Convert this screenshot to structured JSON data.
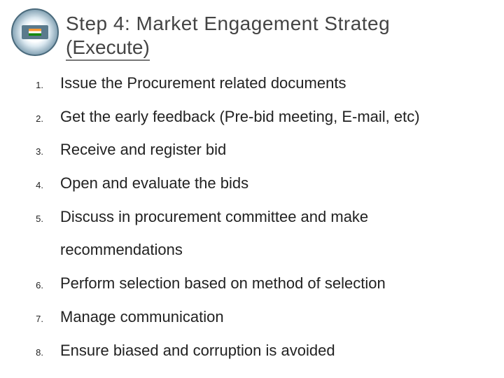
{
  "logo": {
    "name": "institutional-seal"
  },
  "heading": {
    "line1": "Step   4:     Market     Engagement     Strateg",
    "line2": "(Execute)"
  },
  "items": [
    {
      "num": "1.",
      "text": "Issue the Procurement related documents"
    },
    {
      "num": "2.",
      "text": "Get the early feedback (Pre-bid meeting, E-mail, etc)"
    },
    {
      "num": "3.",
      "text": "Receive and register bid"
    },
    {
      "num": "4.",
      "text": "Open and evaluate the bids"
    },
    {
      "num": "5.",
      "text": "Discuss   in   procurement   committee   and   make"
    },
    {
      "num": "",
      "text": "recommendations"
    },
    {
      "num": "6.",
      "text": "Perform selection based on method of selection"
    },
    {
      "num": "7.",
      "text": "Manage communication"
    },
    {
      "num": "8.",
      "text": "Ensure biased and corruption is avoided"
    }
  ]
}
